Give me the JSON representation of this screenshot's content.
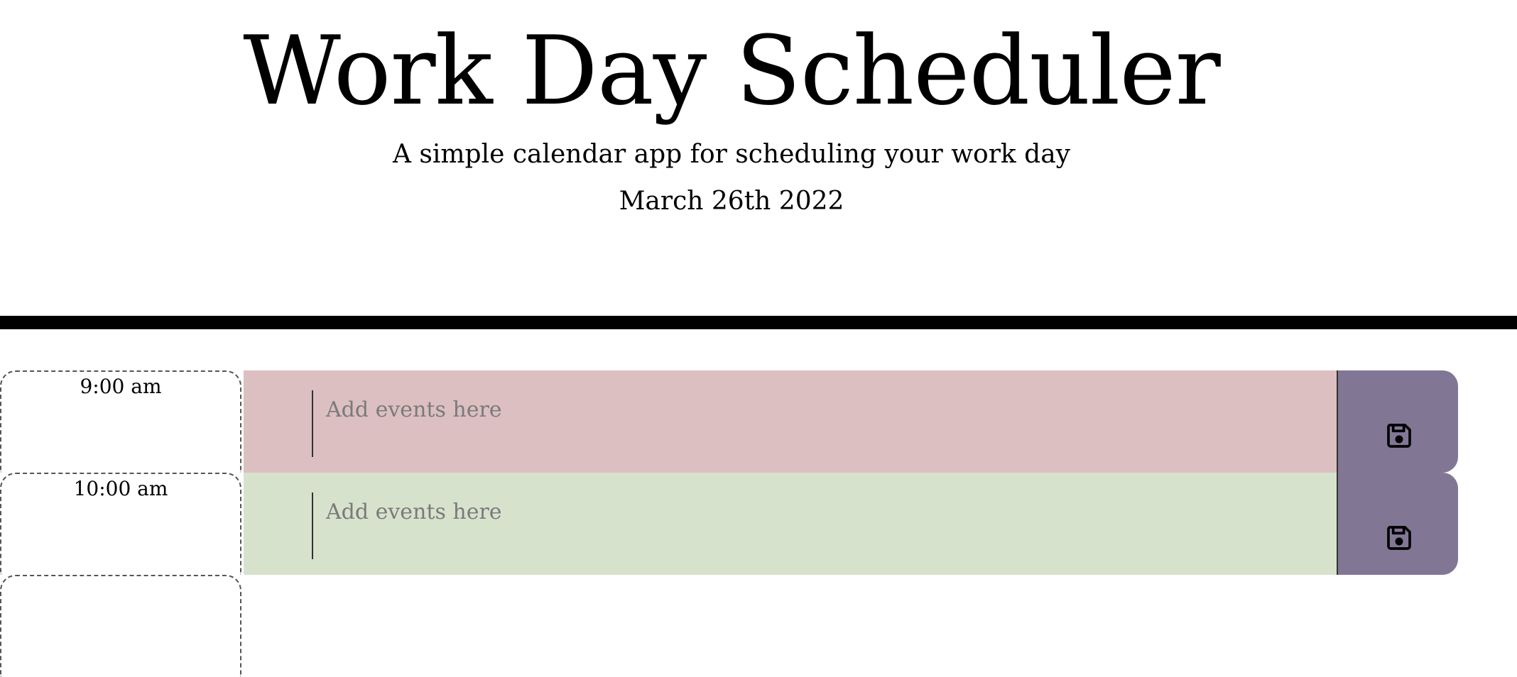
{
  "header": {
    "title": "Work Day Scheduler",
    "subtitle": "A simple calendar app for scheduling your work day",
    "current_date": "March 26th 2022"
  },
  "schedule": {
    "event_placeholder": "Add events here",
    "rows": [
      {
        "hour": "9:00 am",
        "status": "past",
        "color": "#dcbfc1",
        "event": ""
      },
      {
        "hour": "10:00 am",
        "status": "present",
        "color": "#d7e2cd",
        "event": ""
      }
    ],
    "save_button_color": "#817795",
    "save_icon": "floppy-disk-icon"
  }
}
